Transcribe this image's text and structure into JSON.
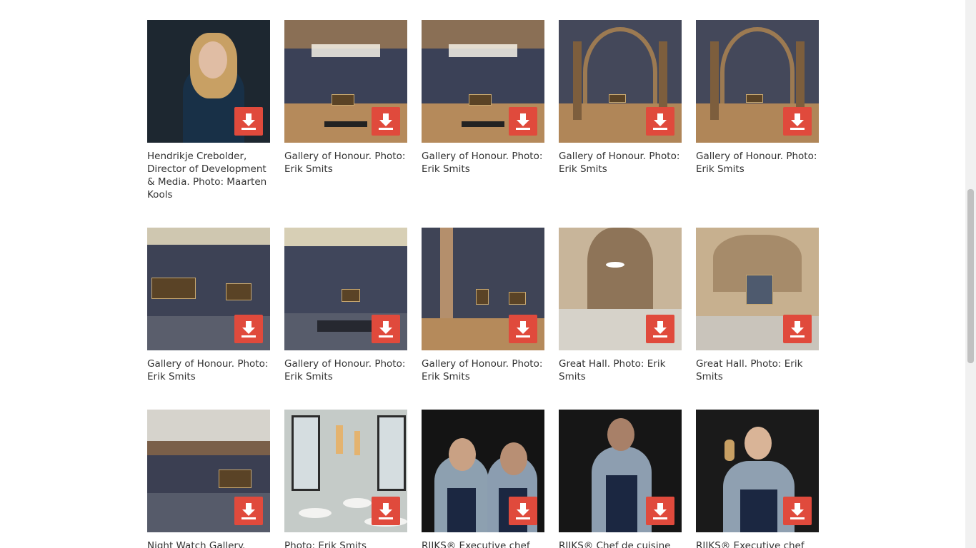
{
  "colors": {
    "download_bg": "#e04a3c",
    "caption_text": "#333333"
  },
  "download": {
    "icon": "download-arrow-icon"
  },
  "gallery": {
    "items": [
      {
        "caption": "Hendrikje Crebolder, Director of Development & Media. Photo: Maarten Kools",
        "scene": "portrait-woman"
      },
      {
        "caption": "Gallery of Honour. Photo: Erik Smits",
        "scene": "gallery-skylight"
      },
      {
        "caption": "Gallery of Honour. Photo: Erik Smits",
        "scene": "gallery-skylight"
      },
      {
        "caption": "Gallery of Honour. Photo: Erik Smits",
        "scene": "gallery-arches"
      },
      {
        "caption": "Gallery of Honour. Photo: Erik Smits",
        "scene": "gallery-arches"
      },
      {
        "caption": "Gallery of Honour. Photo: Erik Smits",
        "scene": "gallery-wall"
      },
      {
        "caption": "Gallery of Honour. Photo: Erik Smits",
        "scene": "gallery-bench"
      },
      {
        "caption": "Gallery of Honour. Photo: Erik Smits",
        "scene": "gallery-corner"
      },
      {
        "caption": "Great Hall. Photo: Erik Smits",
        "scene": "great-hall"
      },
      {
        "caption": "Great Hall. Photo: Erik Smits",
        "scene": "great-hall-2"
      },
      {
        "caption": "Night Watch Gallery. Photo:",
        "scene": "night-watch"
      },
      {
        "caption": "Photo: Erik Smits",
        "scene": "restaurant"
      },
      {
        "caption": "RIJKS® Executive chef Joris",
        "scene": "chefs-two"
      },
      {
        "caption": "RIJKS® Chef de cuisine Ivan",
        "scene": "chef-one"
      },
      {
        "caption": "RIJKS® Executive chef Joris",
        "scene": "chef-seated"
      }
    ]
  }
}
